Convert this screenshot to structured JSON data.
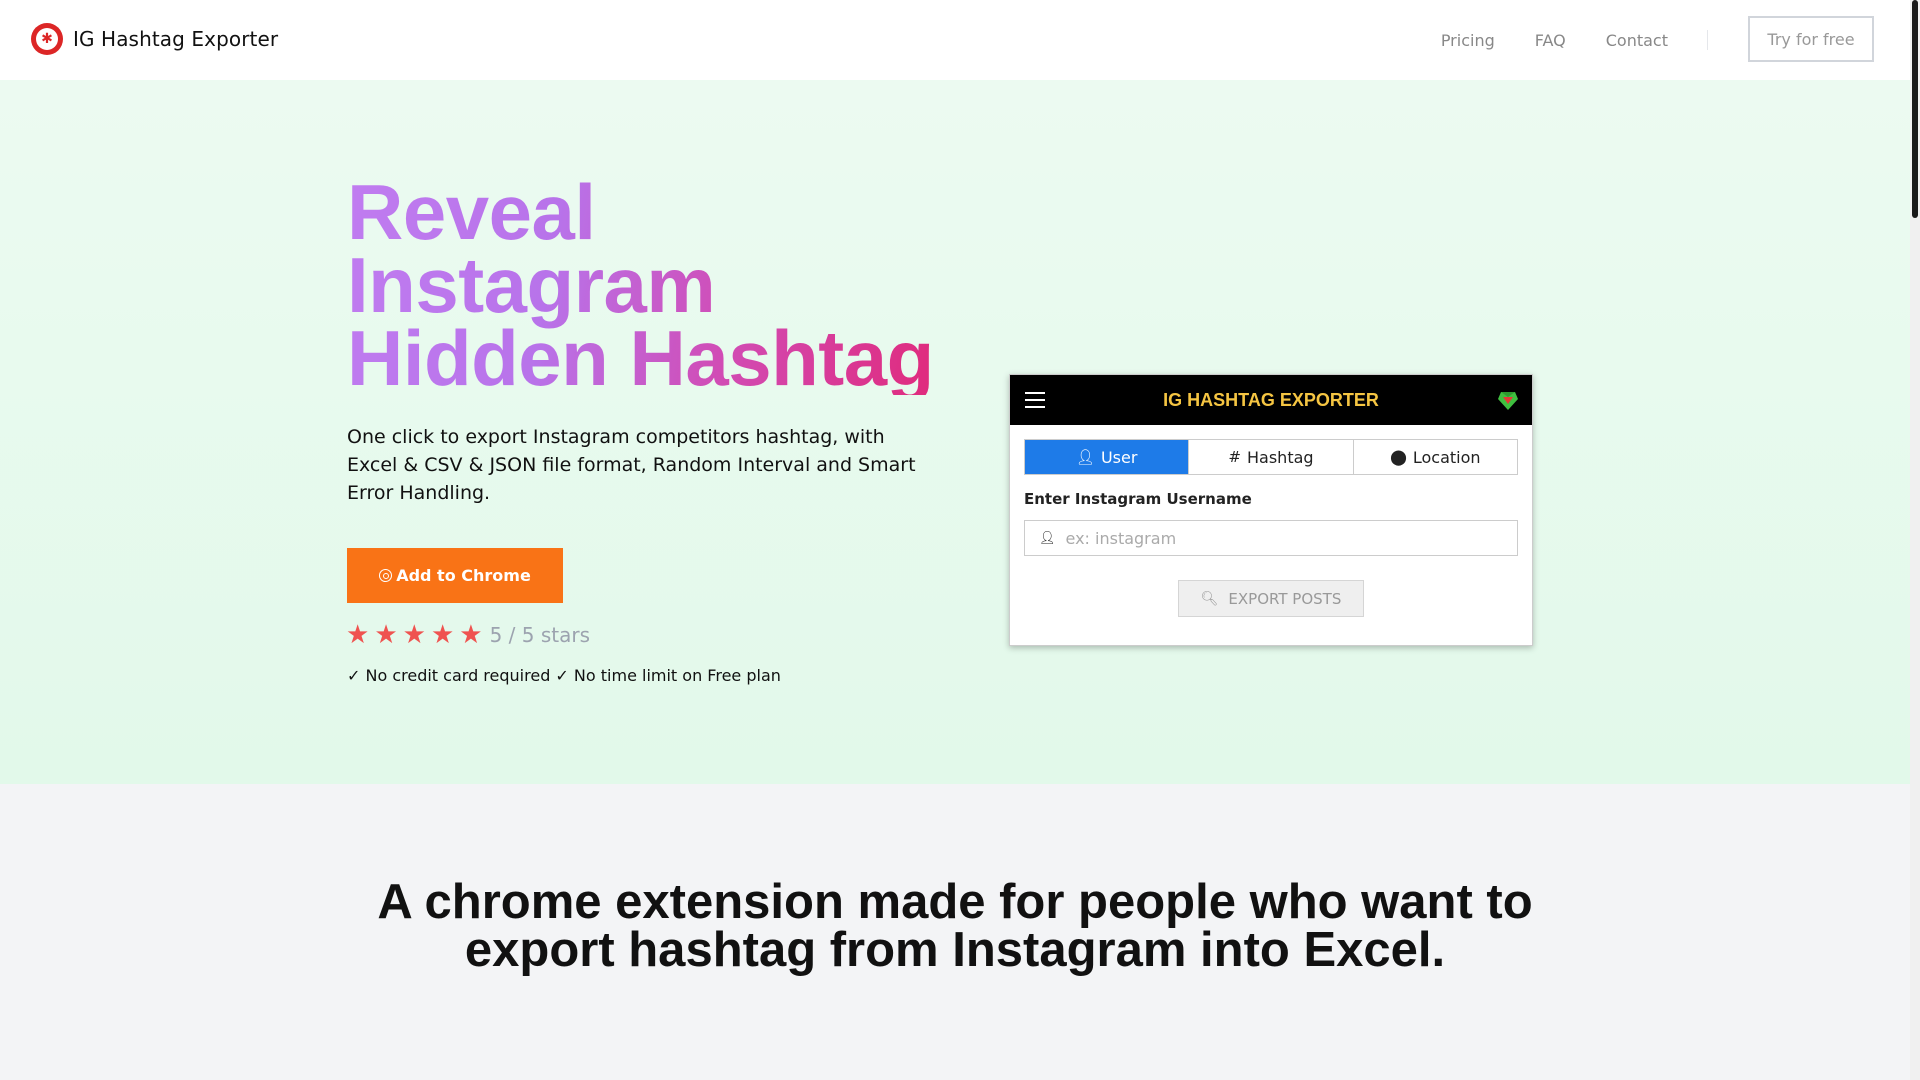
{
  "nav": {
    "brand": "IG Hashtag Exporter",
    "links": [
      "Pricing",
      "FAQ",
      "Contact"
    ],
    "cta": "Try for free"
  },
  "hero": {
    "headline_lines": [
      "Reveal",
      "Instagram",
      "Hidden Hashtag"
    ],
    "subtext": "One click to export Instagram competitors hashtag, with Excel & CSV & JSON file format, Random Interval and Smart Error Handling.",
    "add_button": "Add to Chrome",
    "rating": {
      "stars": 5,
      "max": 5,
      "text": "5 / 5 stars"
    },
    "checks": "✓ No credit card required ✓ No time limit on Free plan"
  },
  "widget": {
    "title": "IG HASHTAG EXPORTER",
    "tabs": [
      "User",
      "Hashtag",
      "Location"
    ],
    "active_tab": "User",
    "label": "Enter Instagram Username",
    "placeholder": "ex: instagram",
    "export_button": "EXPORT POSTS"
  },
  "section": {
    "title": "A chrome extension made for people who want to export hashtag from Instagram into Excel."
  },
  "colors": {
    "accent_orange": "#f97316",
    "tab_active": "#1e7be8",
    "widget_title": "#f5c542",
    "star": "#ef5350",
    "brand_red": "#dc2626"
  }
}
